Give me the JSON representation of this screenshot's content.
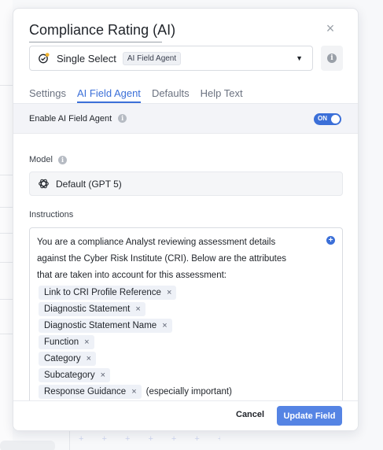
{
  "modal": {
    "title": "Compliance Rating (AI)",
    "close_icon": "close-icon",
    "field_type": {
      "label": "Single Select",
      "badge": "AI Field Agent",
      "icon": "single-select-icon"
    },
    "info_icon": "info-icon"
  },
  "tabs": [
    {
      "label": "Settings",
      "active": false
    },
    {
      "label": "AI Field Agent",
      "active": true
    },
    {
      "label": "Defaults",
      "active": false
    },
    {
      "label": "Help Text",
      "active": false
    }
  ],
  "enable_agent": {
    "label": "Enable AI Field Agent",
    "toggle_text": "ON",
    "enabled": true
  },
  "model": {
    "label": "Model",
    "value": "Default (GPT 5)",
    "icon": "openai-icon"
  },
  "instructions": {
    "label": "Instructions",
    "text_lines": [
      "You are a compliance Analyst reviewing assessment details",
      "against the Cyber Risk Institute (CRI). Below are the attributes",
      "that are taken into account for this assessment:"
    ],
    "chips": [
      {
        "label": "Link to CRI Profile Reference",
        "suffix": ""
      },
      {
        "label": "Diagnostic Statement",
        "suffix": ""
      },
      {
        "label": "Diagnostic Statement Name",
        "suffix": ""
      },
      {
        "label": "Function",
        "suffix": ""
      },
      {
        "label": "Category",
        "suffix": ""
      },
      {
        "label": "Subcategory",
        "suffix": ""
      },
      {
        "label": "Response Guidance",
        "suffix": "(especially important)"
      }
    ],
    "chip_remove_glyph": "×"
  },
  "footer": {
    "cancel_label": "Cancel",
    "update_label": "Update Field"
  },
  "colors": {
    "accent": "#3b6fd8",
    "update_button": "#5584e4",
    "chip_bg": "#eef1f7"
  }
}
